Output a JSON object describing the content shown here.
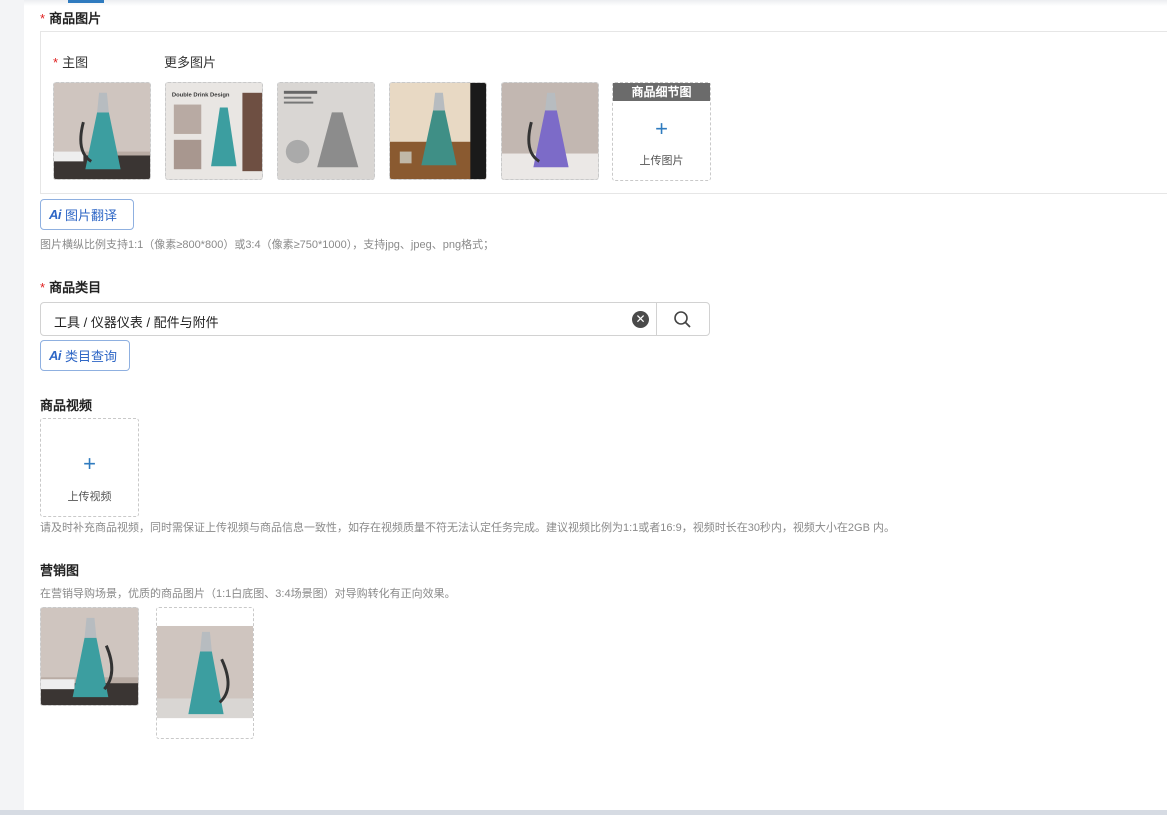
{
  "product_images": {
    "label": "商品图片",
    "main_label": "主图",
    "more_label": "更多图片",
    "thumbs": [
      {
        "name": "main-image",
        "scene": "teal"
      },
      {
        "name": "more-image-1",
        "scene": "double",
        "caption": "Double Drink Design"
      },
      {
        "name": "more-image-2",
        "scene": "grey"
      },
      {
        "name": "more-image-3",
        "scene": "table"
      },
      {
        "name": "more-image-4",
        "scene": "purple"
      }
    ],
    "detail_header": "商品细节图",
    "detail_upload": "上传图片",
    "ai_translate": "图片翻译",
    "hint": "图片横纵比例支持1:1（像素≥800*800）或3:4（像素≥750*1000），支持jpg、jpeg、png格式；"
  },
  "category": {
    "label": "商品类目",
    "value": "工具 / 仪器仪表 / 配件与附件",
    "ai_query": "类目查询"
  },
  "video": {
    "label": "商品视频",
    "upload": "上传视频",
    "hint": "请及时补充商品视频，同时需保证上传视频与商品信息一致性，如存在视频质量不符无法认定任务完成。建议视频比例为1:1或者16:9，视频时长在30秒内，视频大小在2GB 内。"
  },
  "marketing": {
    "label": "营销图",
    "hint": "在营销导购场景，优质的商品图片（1:1白底图、3:4场景图）对导购转化有正向效果。"
  },
  "ai_mark": "Ai",
  "colors": {
    "accent": "#2f67c6",
    "required": "#e02020",
    "plus": "#2f7bbf"
  }
}
